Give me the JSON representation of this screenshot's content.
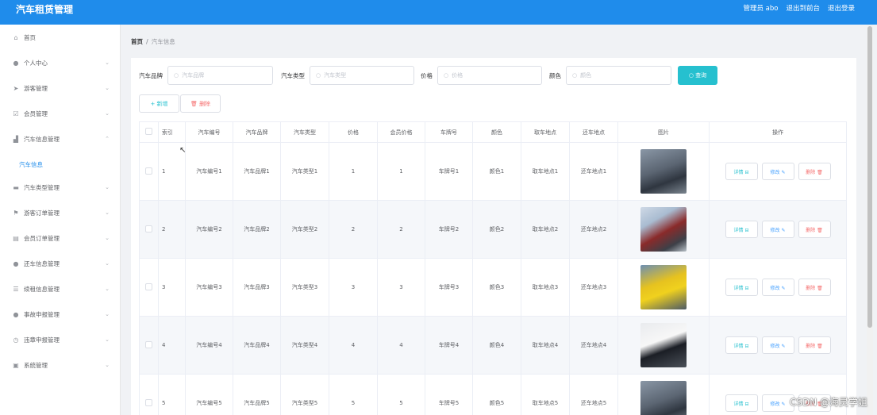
{
  "app": {
    "title": "汽车租赁管理"
  },
  "topbar": {
    "user": "管理员 abo",
    "back_to_front": "退出到前台",
    "logout": "退出登录"
  },
  "sidebar": {
    "items": [
      {
        "label": "首页",
        "icon": "home-icon"
      },
      {
        "label": "个人中心",
        "icon": "user-icon"
      },
      {
        "label": "游客管理",
        "icon": "send-icon"
      },
      {
        "label": "会员管理",
        "icon": "check-square-icon"
      },
      {
        "label": "汽车信息管理",
        "icon": "chart-icon"
      },
      {
        "label": "汽车类型管理",
        "icon": "card-icon"
      },
      {
        "label": "游客订单管理",
        "icon": "flag-icon"
      },
      {
        "label": "会员订单管理",
        "icon": "trash-icon"
      },
      {
        "label": "还车信息管理",
        "icon": "person-icon"
      },
      {
        "label": "续租信息管理",
        "icon": "list-icon"
      },
      {
        "label": "事故申报管理",
        "icon": "pin-icon"
      },
      {
        "label": "违章申报管理",
        "icon": "clock-icon"
      },
      {
        "label": "系统管理",
        "icon": "gift-icon"
      }
    ],
    "active_sub": "汽车信息"
  },
  "breadcrumb": {
    "home": "首页",
    "sep": "/",
    "current": "汽车信息"
  },
  "filters": {
    "brand_label": "汽车品牌",
    "brand_placeholder": "汽车品牌",
    "type_label": "汽车类型",
    "type_placeholder": "汽车类型",
    "price_label": "价格",
    "price_placeholder": "价格",
    "color_label": "颜色",
    "color_placeholder": "颜色",
    "query": "查询"
  },
  "actions": {
    "add": "新增",
    "delete": "删除"
  },
  "table": {
    "headers": [
      "索引",
      "汽车编号",
      "汽车品牌",
      "汽车类型",
      "价格",
      "会员价格",
      "车牌号",
      "颜色",
      "取车地点",
      "还车地点",
      "图片",
      "操作"
    ],
    "rows": [
      [
        "1",
        "汽车编号1",
        "汽车品牌1",
        "汽车类型1",
        "1",
        "1",
        "车牌号1",
        "颜色1",
        "取车地点1",
        "还车地点1"
      ],
      [
        "2",
        "汽车编号2",
        "汽车品牌2",
        "汽车类型2",
        "2",
        "2",
        "车牌号2",
        "颜色2",
        "取车地点2",
        "还车地点2"
      ],
      [
        "3",
        "汽车编号3",
        "汽车品牌3",
        "汽车类型3",
        "3",
        "3",
        "车牌号3",
        "颜色3",
        "取车地点3",
        "还车地点3"
      ],
      [
        "4",
        "汽车编号4",
        "汽车品牌4",
        "汽车类型4",
        "4",
        "4",
        "车牌号4",
        "颜色4",
        "取车地点4",
        "还车地点4"
      ],
      [
        "5",
        "汽车编号5",
        "汽车品牌5",
        "汽车类型5",
        "5",
        "5",
        "车牌号5",
        "颜色5",
        "取车地点5",
        "还车地点5"
      ]
    ],
    "op_detail": "详情 ⊟",
    "op_edit": "修改 ✎",
    "op_delete": "删除 🗑"
  },
  "watermark": "CSDN @海灵学姐",
  "colors": {
    "topbar": "#1f8ceb",
    "accent": "#26c0cf",
    "danger": "#f56c6c"
  }
}
